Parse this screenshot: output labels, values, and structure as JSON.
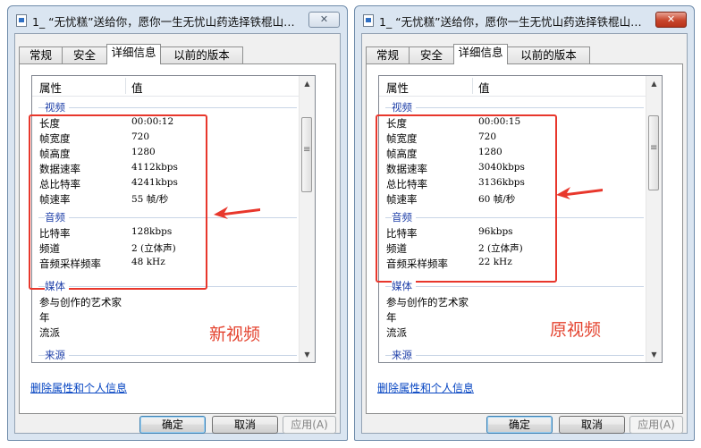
{
  "windows": [
    {
      "title": "1_ “无忧糕”送给你，愿你一生无忧山药选择铁棍山药...",
      "close_label": "✕",
      "tabs": [
        "常规",
        "安全",
        "详细信息",
        "以前的版本"
      ],
      "selected_tab": "详细信息",
      "columns": {
        "property": "属性",
        "value": "值"
      },
      "groups": {
        "video": "视频",
        "audio": "音频",
        "media": "媒体",
        "origin": "来源"
      },
      "video": [
        {
          "k": "长度",
          "v": "00:00:12"
        },
        {
          "k": "帧宽度",
          "v": "720"
        },
        {
          "k": "帧高度",
          "v": "1280"
        },
        {
          "k": "数据速率",
          "v": "4112kbps"
        },
        {
          "k": "总比特率",
          "v": "4241kbps"
        },
        {
          "k": "帧速率",
          "v": "55 帧/秒"
        }
      ],
      "audio": [
        {
          "k": "比特率",
          "v": "128kbps"
        },
        {
          "k": "频道",
          "v": "2 (立体声)"
        },
        {
          "k": "音频采样频率",
          "v": "48 kHz"
        }
      ],
      "media": [
        {
          "k": "参与创作的艺术家",
          "v": ""
        },
        {
          "k": "年",
          "v": ""
        },
        {
          "k": "流派",
          "v": ""
        }
      ],
      "annotation": "新视频",
      "remove_link": "删除属性和个人信息",
      "buttons": {
        "ok": "确定",
        "cancel": "取消",
        "apply": "应用(A)"
      }
    },
    {
      "title": "1_ “无忧糕”送给你，愿你一生无忧山药选择铁棍山药...",
      "close_label": "✕",
      "tabs": [
        "常规",
        "安全",
        "详细信息",
        "以前的版本"
      ],
      "selected_tab": "详细信息",
      "columns": {
        "property": "属性",
        "value": "值"
      },
      "groups": {
        "video": "视频",
        "audio": "音频",
        "media": "媒体",
        "origin": "来源"
      },
      "video": [
        {
          "k": "长度",
          "v": "00:00:15"
        },
        {
          "k": "帧宽度",
          "v": "720"
        },
        {
          "k": "帧高度",
          "v": "1280"
        },
        {
          "k": "数据速率",
          "v": "3040kbps"
        },
        {
          "k": "总比特率",
          "v": "3136kbps"
        },
        {
          "k": "帧速率",
          "v": "60 帧/秒"
        }
      ],
      "audio": [
        {
          "k": "比特率",
          "v": "96kbps"
        },
        {
          "k": "频道",
          "v": "2 (立体声)"
        },
        {
          "k": "音频采样频率",
          "v": "22 kHz"
        }
      ],
      "media": [
        {
          "k": "参与创作的艺术家",
          "v": ""
        },
        {
          "k": "年",
          "v": ""
        },
        {
          "k": "流派",
          "v": ""
        }
      ],
      "annotation": "原视频",
      "remove_link": "删除属性和个人信息",
      "buttons": {
        "ok": "确定",
        "cancel": "取消",
        "apply": "应用(A)"
      }
    }
  ],
  "colors": {
    "highlight_box": "#e8372c",
    "group_header": "#1e3fa8",
    "link": "#0645c2"
  },
  "icons": [
    "file-icon",
    "close-icon",
    "scroll-up-icon",
    "scroll-down-icon",
    "red-arrow-icon"
  ]
}
